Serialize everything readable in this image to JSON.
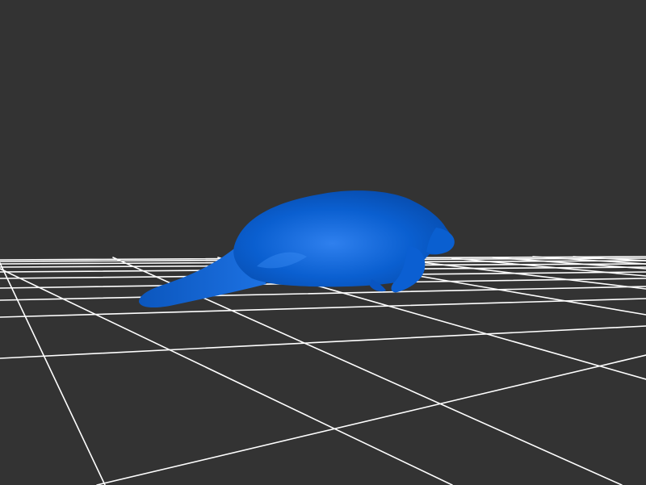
{
  "scene": {
    "background_color": "#333333",
    "grid_color": "#ffffff",
    "grid_visible": true,
    "model_name": "manatee",
    "model_color": "#0a5fd0",
    "model_highlight_color": "#3a8cf5",
    "model_shadow_color": "#0645a3"
  }
}
